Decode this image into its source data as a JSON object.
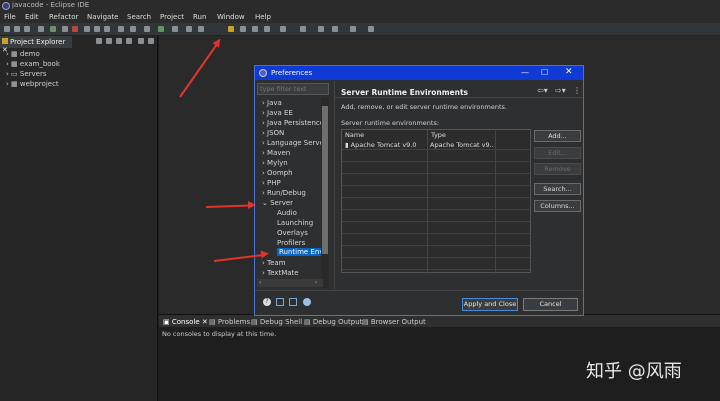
{
  "window": {
    "title": "javacode - Eclipse IDE"
  },
  "menu": [
    "File",
    "Edit",
    "Refactor",
    "Navigate",
    "Search",
    "Project",
    "Run",
    "Window",
    "Help"
  ],
  "project_explorer": {
    "tab_label": "Project Explorer",
    "items": [
      "demo",
      "exam_book",
      "Servers",
      "webproject"
    ]
  },
  "console": {
    "tabs": [
      "Console",
      "Problems",
      "Debug Shell",
      "Debug Output",
      "Browser Output"
    ],
    "message": "No consoles to display at this time."
  },
  "dialog": {
    "title": "Preferences",
    "filter_placeholder": "type filter text",
    "nav": [
      {
        "label": "Java",
        "child": false
      },
      {
        "label": "Java EE",
        "child": false
      },
      {
        "label": "Java Persistence",
        "child": false
      },
      {
        "label": "JSON",
        "child": false
      },
      {
        "label": "Language Server",
        "child": false
      },
      {
        "label": "Maven",
        "child": false
      },
      {
        "label": "Mylyn",
        "child": false
      },
      {
        "label": "Oomph",
        "child": false
      },
      {
        "label": "PHP",
        "child": false
      },
      {
        "label": "Run/Debug",
        "child": false
      },
      {
        "label": "Server",
        "child": false,
        "expanded": true
      },
      {
        "label": "Audio",
        "child": true
      },
      {
        "label": "Launching",
        "child": true
      },
      {
        "label": "Overlays",
        "child": true
      },
      {
        "label": "Profilers",
        "child": true
      },
      {
        "label": "Runtime Envir",
        "child": true,
        "selected": true
      },
      {
        "label": "Team",
        "child": false
      },
      {
        "label": "TextMate",
        "child": false
      }
    ],
    "page_title": "Server Runtime Environments",
    "description": "Add, remove, or edit server runtime environments.",
    "env_label": "Server runtime environments:",
    "table": {
      "columns": [
        "Name",
        "Type"
      ],
      "rows": [
        {
          "name": "Apache Tomcat v9.0",
          "type": "Apache Tomcat v9..."
        }
      ]
    },
    "side_buttons": [
      {
        "label": "Add...",
        "enabled": true
      },
      {
        "label": "Edit...",
        "enabled": false
      },
      {
        "label": "Remove",
        "enabled": false
      },
      {
        "label": "Search...",
        "enabled": true
      },
      {
        "label": "Columns...",
        "enabled": true
      }
    ],
    "apply_close": "Apply and Close",
    "cancel": "Cancel"
  },
  "watermark": "知乎 @风雨",
  "colors": {
    "dialog_title": "#0f3ad6",
    "arrow": "#e0352b",
    "selection": "#0a64c8"
  }
}
